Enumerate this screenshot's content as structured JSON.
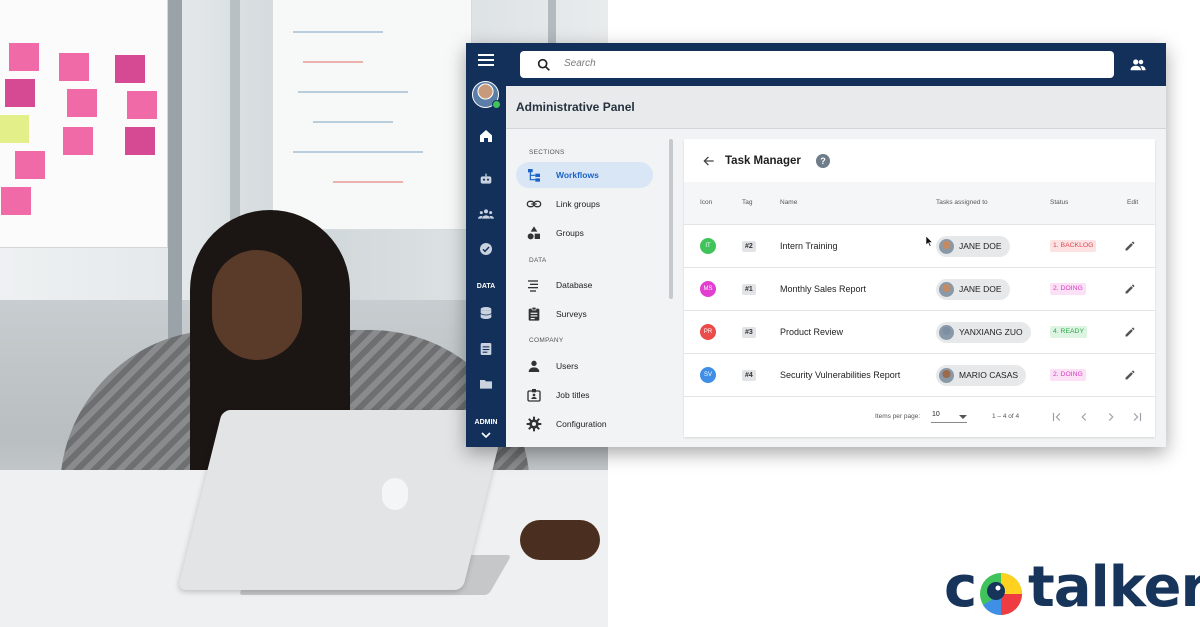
{
  "app": {
    "search_placeholder": "Search",
    "header_title": "Administrative Panel",
    "brand_color": "#12305a",
    "rail": {
      "data_label": "DATA",
      "admin_label": "ADMIN",
      "icons": [
        "home-icon",
        "robot-icon",
        "team-icon",
        "check-circle-icon",
        "database-icon",
        "document-icon",
        "folder-icon"
      ]
    },
    "nav": {
      "sections": [
        "SECTIONS",
        "DATA",
        "COMPANY"
      ],
      "items": [
        {
          "label": "Workflows",
          "icon": "workflow-icon",
          "active": true
        },
        {
          "label": "Link groups",
          "icon": "link-icon"
        },
        {
          "label": "Groups",
          "icon": "shapes-icon"
        },
        {
          "label": "Database",
          "icon": "list-icon"
        },
        {
          "label": "Surveys",
          "icon": "clipboard-icon"
        },
        {
          "label": "Users",
          "icon": "person-icon"
        },
        {
          "label": "Job titles",
          "icon": "badge-icon"
        },
        {
          "label": "Configuration",
          "icon": "gear-icon"
        }
      ]
    },
    "task_manager": {
      "title": "Task Manager",
      "help": "?",
      "columns": [
        "Icon",
        "Tag",
        "Name",
        "Tasks assigned to",
        "Status",
        "Edit"
      ],
      "rows": [
        {
          "icon_text": "IT",
          "icon_color": "#3fc35a",
          "tag": "#2",
          "name": "Intern Training",
          "assignee": "JANE DOE",
          "status": "1. BACKLOG",
          "status_fg": "#e0464f",
          "status_bg": "#fde2e3"
        },
        {
          "icon_text": "MS",
          "icon_color": "#e23fd0",
          "tag": "#1",
          "name": "Monthly Sales Report",
          "assignee": "JANE DOE",
          "status": "2. DOING",
          "status_fg": "#d43fbf",
          "status_bg": "#fbe0f6"
        },
        {
          "icon_text": "PR",
          "icon_color": "#ea4b4b",
          "tag": "#3",
          "name": "Product Review",
          "assignee": "YANXIANG ZUO",
          "status": "4. READY",
          "status_fg": "#2fa94a",
          "status_bg": "#dcf4e1"
        },
        {
          "icon_text": "SV",
          "icon_color": "#3f8fe6",
          "tag": "#4",
          "name": "Security Vulnerabilities Report",
          "assignee": "MARIO CASAS",
          "status": "2. DOING",
          "status_fg": "#d43fbf",
          "status_bg": "#fbe0f6"
        }
      ],
      "items_per_page_label": "Items per page:",
      "items_per_page_value": "10",
      "range": "1 – 4 of 4"
    }
  },
  "logo": {
    "text_left": "c",
    "text_right": "talker",
    "colors": {
      "navy": "#17345a",
      "yellow": "#ffd21f",
      "red": "#ef3b42",
      "green": "#3fc35a",
      "blue": "#3f8fe6"
    }
  }
}
